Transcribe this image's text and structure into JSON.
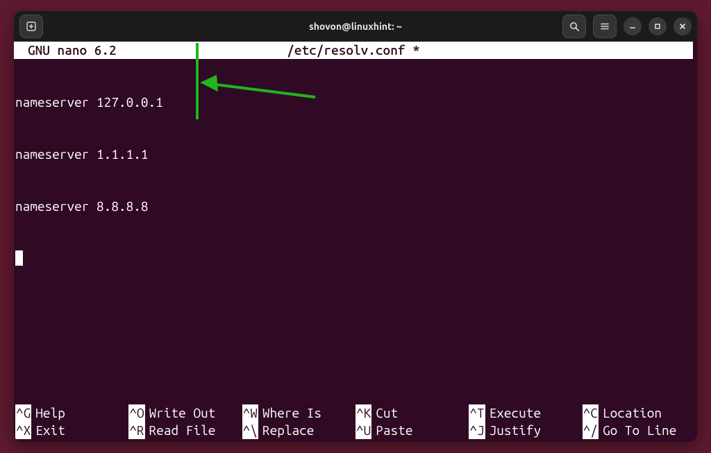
{
  "titlebar": {
    "title": "shovon@linuxhint: ~"
  },
  "nano": {
    "app_name": "GNU nano 6.2",
    "file_label": "/etc/resolv.conf *"
  },
  "editor": {
    "lines": [
      "nameserver 127.0.0.1",
      "nameserver 1.1.1.1",
      "nameserver 8.8.8.8"
    ]
  },
  "shortcuts": {
    "row1": [
      {
        "key": "^G",
        "label": "Help"
      },
      {
        "key": "^O",
        "label": "Write Out"
      },
      {
        "key": "^W",
        "label": "Where Is"
      },
      {
        "key": "^K",
        "label": "Cut"
      },
      {
        "key": "^T",
        "label": "Execute"
      },
      {
        "key": "^C",
        "label": "Location"
      }
    ],
    "row2": [
      {
        "key": "^X",
        "label": "Exit"
      },
      {
        "key": "^R",
        "label": "Read File"
      },
      {
        "key": "^\\",
        "label": "Replace"
      },
      {
        "key": "^U",
        "label": "Paste"
      },
      {
        "key": "^J",
        "label": "Justify"
      },
      {
        "key": "^/",
        "label": "Go To Line"
      }
    ]
  },
  "annotation": {
    "color": "#1fb61f"
  }
}
